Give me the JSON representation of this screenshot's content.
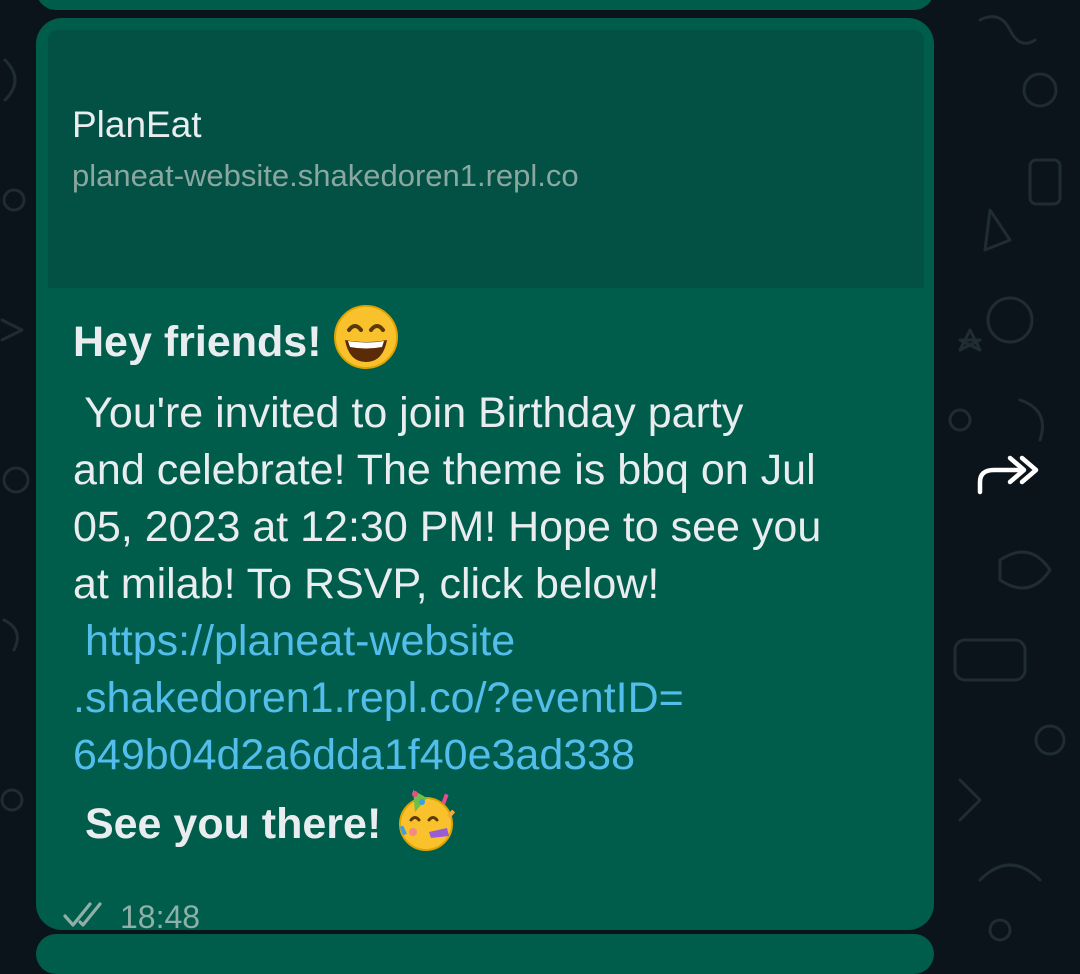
{
  "message": {
    "preview": {
      "title": "PlanEat",
      "url": "planeat-website.shakedoren1.repl.co"
    },
    "greeting": "Hey friends!",
    "greeting_emoji": "grinning-face-emoji",
    "body_lines": [
      " You're invited to join Birthday party",
      "and celebrate! The theme is bbq on Jul",
      "05, 2023 at 12:30 PM! Hope to see you",
      "at milab! To RSVP, click below!"
    ],
    "link_lines": [
      " https://planeat-website",
      ".shakedoren1.repl.co/?eventID=",
      "649b04d2a6dda1f40e3ad338"
    ],
    "closing": " See you there!",
    "closing_emoji": "partying-face-emoji",
    "time": "18:48",
    "status_icon": "double-check-icon"
  },
  "colors": {
    "background": "#0b141a",
    "bubble": "#005c4b",
    "preview": "#025144",
    "link": "#53bdeb",
    "text": "#e9edef"
  },
  "forward_icon": "forward-icon"
}
